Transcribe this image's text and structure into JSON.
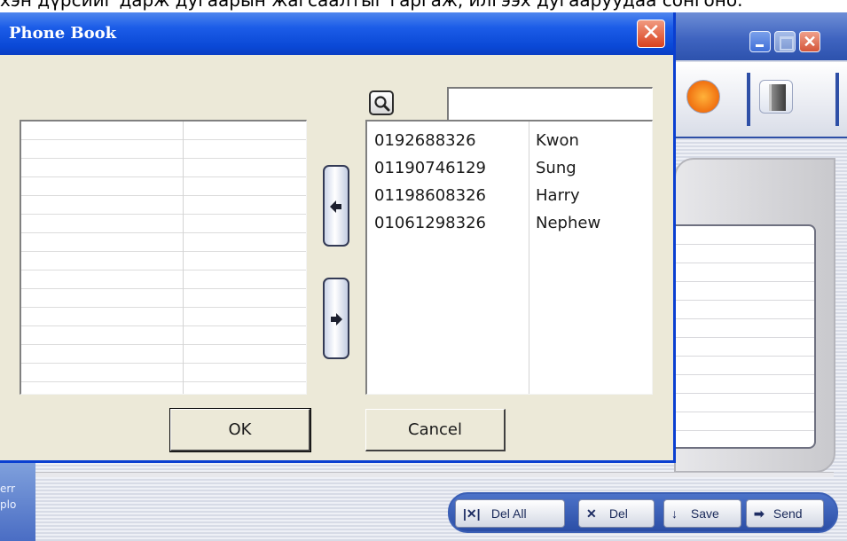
{
  "top_caption": "хэн дүрсийг дарж дугаарын жагсаалтыг гаргаж, илгээх дугааруудаа сонгоно.",
  "dialog": {
    "title": "Phone Book",
    "close_glyph": "✕",
    "search_value": "",
    "ok_label": "OK",
    "cancel_label": "Cancel",
    "left_list": [],
    "right_list": [
      {
        "number": "0192688326",
        "name": "Kwon"
      },
      {
        "number": "01190746129",
        "name": "Sung"
      },
      {
        "number": "01198608326",
        "name": "Harry"
      },
      {
        "number": "01061298326",
        "name": "Nephew"
      }
    ]
  },
  "background_app": {
    "left_bar_text_1": "err",
    "left_bar_text_2": "plo",
    "close_glyph": "✕",
    "actions": {
      "del_all": {
        "icon": "|✕|",
        "label": "Del All"
      },
      "del": {
        "icon": "✕",
        "label": "Del"
      },
      "save": {
        "icon": "↓",
        "label": "Save"
      },
      "send": {
        "icon": "➡",
        "label": "Send"
      }
    }
  },
  "colors": {
    "titlebar_blue": "#0a48d6",
    "dialog_face": "#ece9d8",
    "close_red": "#d8411e"
  }
}
